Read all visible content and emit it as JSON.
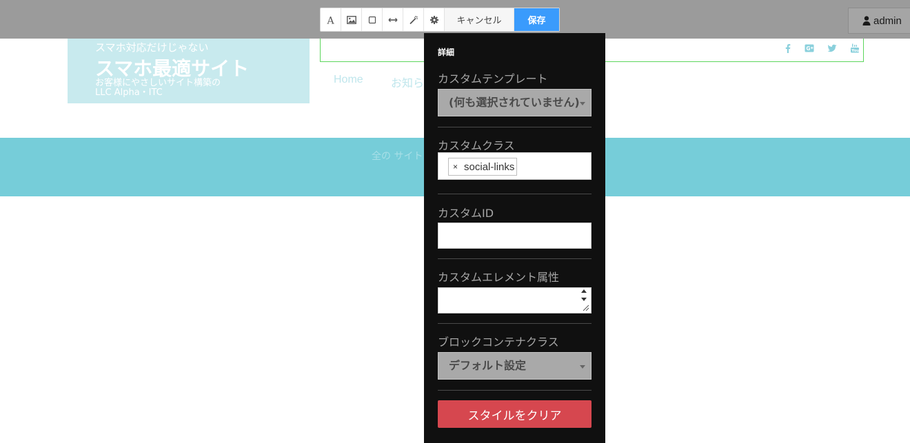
{
  "site": {
    "tagline": "スマホ対応だけじゃない",
    "title": "スマホ最適サイト",
    "subtitle": "お客様にやさしいサイト構築の",
    "company": "LLC Alpha・ITC",
    "nav": [
      "Home",
      "お知ら"
    ],
    "band_text": "全の サイト",
    "social_icons": [
      "facebook-icon",
      "google-plus-icon",
      "twitter-icon",
      "youtube-icon"
    ]
  },
  "topbar": {
    "admin_label": "admin",
    "toolbar_icons": [
      "text-icon",
      "image-icon",
      "box-icon",
      "divider-icon",
      "magic-wand-icon",
      "gear-icon"
    ],
    "cancel_label": "キャンセル",
    "save_label": "保存"
  },
  "panel": {
    "title": "詳細",
    "custom_template_label": "カスタムテンプレート",
    "custom_template_value": "(何も選択されていません)",
    "custom_class_label": "カスタムクラス",
    "custom_class_tag": "social-links",
    "custom_class_tag_remove": "×",
    "custom_id_label": "カスタムID",
    "custom_id_value": "",
    "custom_attr_label": "カスタムエレメント属性",
    "custom_attr_value": "",
    "block_container_label": "ブロックコンテナクラス",
    "block_container_value": "デフォルト設定",
    "clear_style_label": "スタイルをクリア"
  },
  "colors": {
    "accent_blue": "#3a9bfc",
    "danger_red": "#d6474f",
    "band_teal": "#76cdd9",
    "panel_bg": "#101010"
  }
}
